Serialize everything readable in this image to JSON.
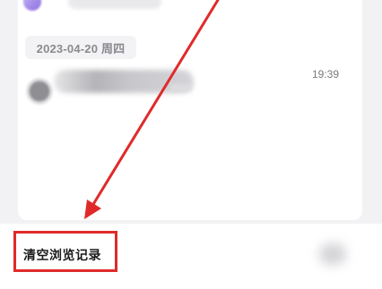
{
  "history": {
    "date_label": "2023-04-20 周四",
    "items": [
      {
        "time": "19:39"
      }
    ]
  },
  "bottom_bar": {
    "clear_label": "清空浏览记录"
  },
  "colors": {
    "annotation": "#e02a2a",
    "background": "#f2f2f4",
    "card": "#ffffff",
    "date_chip_text": "#8a8a8f"
  }
}
